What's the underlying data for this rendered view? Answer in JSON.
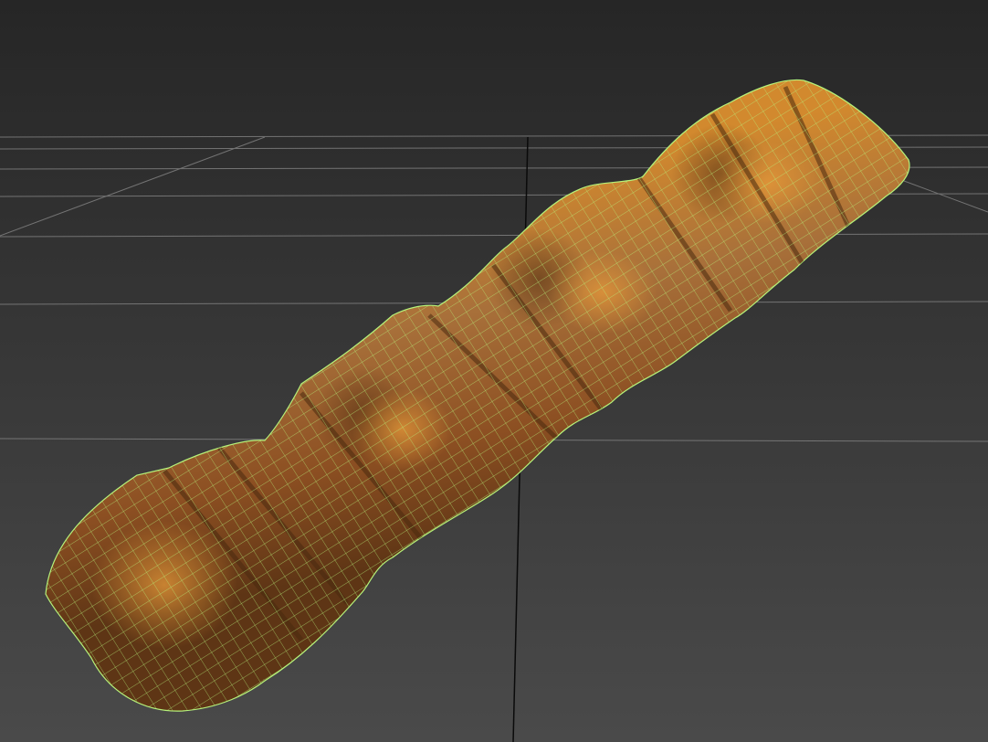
{
  "viewport": {
    "projection": "perspective",
    "shading": "smooth-with-wireframe",
    "background_top": "#262626",
    "background_bottom": "#4a4a4a",
    "grid_color": "#8a8a8a",
    "grid_axis_color": "#0a0a0a",
    "mesh_color": "#a8703a",
    "mesh_highlight": "#d2892e",
    "mesh_shadow": "#5e3515",
    "wire_color": "#b6f27a"
  }
}
